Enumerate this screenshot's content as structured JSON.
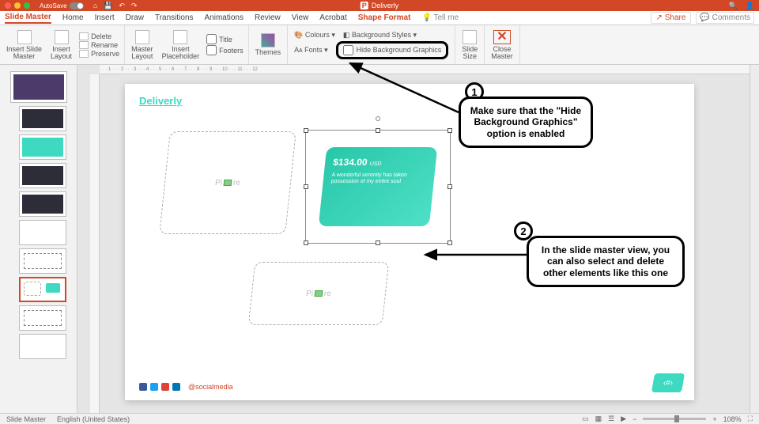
{
  "titlebar": {
    "autosave": "AutoSave",
    "doc": "Deliverly"
  },
  "tabs": {
    "slide_master": "Slide Master",
    "home": "Home",
    "insert": "Insert",
    "draw": "Draw",
    "transitions": "Transitions",
    "animations": "Animations",
    "review": "Review",
    "view": "View",
    "acrobat": "Acrobat",
    "shape_format": "Shape Format",
    "tell_me": "Tell me",
    "share": "Share",
    "comments": "Comments"
  },
  "ribbon": {
    "insert_slide_master": "Insert Slide\nMaster",
    "insert_layout": "Insert\nLayout",
    "delete": "Delete",
    "rename": "Rename",
    "preserve": "Preserve",
    "master_layout": "Master\nLayout",
    "insert_placeholder": "Insert\nPlaceholder",
    "title": "Title",
    "footers": "Footers",
    "themes": "Themes",
    "colours": "Colours",
    "fonts": "Fonts",
    "background_styles": "Background Styles",
    "hide_bg": "Hide Background Graphics",
    "slide_size": "Slide\nSize",
    "close_master": "Close\nMaster"
  },
  "slide": {
    "brand": "Deliverly",
    "placeholder": "Pi",
    "placeholder2": "re",
    "price": "$134.00",
    "currency": "USD",
    "desc": "A wonderful serenity has taken possession of my entire soul",
    "social": "@socialmedia",
    "tag": "‹#›"
  },
  "callouts": {
    "c1_num": "1",
    "c1_text": "Make sure that the \"Hide Background Graphics\" option is enabled",
    "c2_num": "2",
    "c2_text": "In the slide master view, you can also select and delete other elements like this one"
  },
  "status": {
    "mode": "Slide Master",
    "lang": "English (United States)",
    "zoom": "108%"
  }
}
